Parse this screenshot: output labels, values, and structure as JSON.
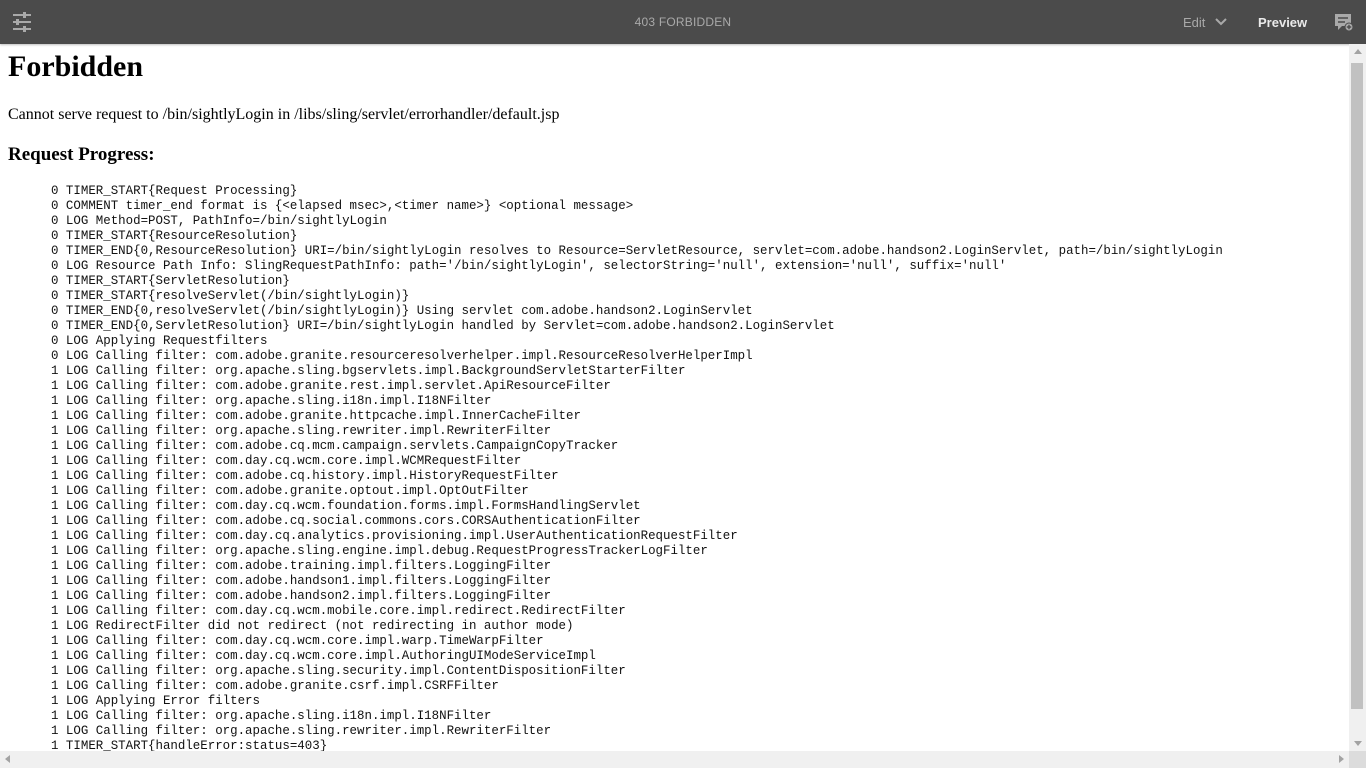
{
  "toolbar": {
    "title": "403 FORBIDDEN",
    "edit_label": "Edit",
    "preview_label": "Preview",
    "icons": {
      "left": "side-panel-toggle-icon",
      "mode_menu": "chevron-down-icon",
      "right": "annotate-icon"
    },
    "colors": {
      "background": "#4b4b4b",
      "text_dim": "#a9a9a9",
      "text_bright": "#eaeaea"
    }
  },
  "page": {
    "heading": "Forbidden",
    "message": "Cannot serve request to /bin/sightlyLogin in /libs/sling/servlet/errorhandler/default.jsp",
    "progress_heading": "Request Progress:",
    "log_lines": [
      "0 TIMER_START{Request Processing}",
      "0 COMMENT timer_end format is {<elapsed msec>,<timer name>} <optional message>",
      "0 LOG Method=POST, PathInfo=/bin/sightlyLogin",
      "0 TIMER_START{ResourceResolution}",
      "0 TIMER_END{0,ResourceResolution} URI=/bin/sightlyLogin resolves to Resource=ServletResource, servlet=com.adobe.handson2.LoginServlet, path=/bin/sightlyLogin",
      "0 LOG Resource Path Info: SlingRequestPathInfo: path='/bin/sightlyLogin', selectorString='null', extension='null', suffix='null'",
      "0 TIMER_START{ServletResolution}",
      "0 TIMER_START{resolveServlet(/bin/sightlyLogin)}",
      "0 TIMER_END{0,resolveServlet(/bin/sightlyLogin)} Using servlet com.adobe.handson2.LoginServlet",
      "0 TIMER_END{0,ServletResolution} URI=/bin/sightlyLogin handled by Servlet=com.adobe.handson2.LoginServlet",
      "0 LOG Applying Requestfilters",
      "0 LOG Calling filter: com.adobe.granite.resourceresolverhelper.impl.ResourceResolverHelperImpl",
      "1 LOG Calling filter: org.apache.sling.bgservlets.impl.BackgroundServletStarterFilter",
      "1 LOG Calling filter: com.adobe.granite.rest.impl.servlet.ApiResourceFilter",
      "1 LOG Calling filter: org.apache.sling.i18n.impl.I18NFilter",
      "1 LOG Calling filter: com.adobe.granite.httpcache.impl.InnerCacheFilter",
      "1 LOG Calling filter: org.apache.sling.rewriter.impl.RewriterFilter",
      "1 LOG Calling filter: com.adobe.cq.mcm.campaign.servlets.CampaignCopyTracker",
      "1 LOG Calling filter: com.day.cq.wcm.core.impl.WCMRequestFilter",
      "1 LOG Calling filter: com.adobe.cq.history.impl.HistoryRequestFilter",
      "1 LOG Calling filter: com.adobe.granite.optout.impl.OptOutFilter",
      "1 LOG Calling filter: com.day.cq.wcm.foundation.forms.impl.FormsHandlingServlet",
      "1 LOG Calling filter: com.adobe.cq.social.commons.cors.CORSAuthenticationFilter",
      "1 LOG Calling filter: com.day.cq.analytics.provisioning.impl.UserAuthenticationRequestFilter",
      "1 LOG Calling filter: org.apache.sling.engine.impl.debug.RequestProgressTrackerLogFilter",
      "1 LOG Calling filter: com.adobe.training.impl.filters.LoggingFilter",
      "1 LOG Calling filter: com.adobe.handson1.impl.filters.LoggingFilter",
      "1 LOG Calling filter: com.adobe.handson2.impl.filters.LoggingFilter",
      "1 LOG Calling filter: com.day.cq.wcm.mobile.core.impl.redirect.RedirectFilter",
      "1 LOG RedirectFilter did not redirect (not redirecting in author mode)",
      "1 LOG Calling filter: com.day.cq.wcm.core.impl.warp.TimeWarpFilter",
      "1 LOG Calling filter: com.day.cq.wcm.core.impl.AuthoringUIModeServiceImpl",
      "1 LOG Calling filter: org.apache.sling.security.impl.ContentDispositionFilter",
      "1 LOG Calling filter: com.adobe.granite.csrf.impl.CSRFFilter",
      "1 LOG Applying Error filters",
      "1 LOG Calling filter: org.apache.sling.i18n.impl.I18NFilter",
      "1 LOG Calling filter: org.apache.sling.rewriter.impl.RewriterFilter",
      "1 TIMER_START{handleError:status=403}"
    ]
  }
}
